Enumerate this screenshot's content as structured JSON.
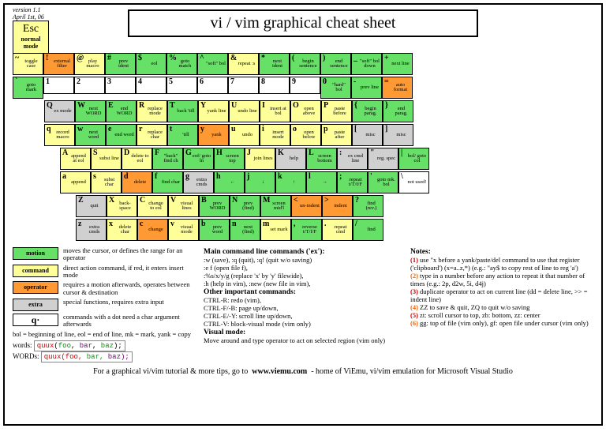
{
  "meta": {
    "version": "version 1.1",
    "date": "April 1st, 06"
  },
  "title": "vi / vim graphical cheat sheet",
  "esc": {
    "key": "Esc",
    "label": "normal mode"
  },
  "row1": [
    {
      "c": "~",
      "l": "toggle case",
      "cls": "y"
    },
    {
      "c": "!",
      "l": "external filter",
      "cls": "o"
    },
    {
      "c": "@",
      "l": "play macro",
      "cls": "y"
    },
    {
      "c": "#",
      "l": "prev ident",
      "cls": "g"
    },
    {
      "c": "$",
      "l": "eol",
      "cls": "g"
    },
    {
      "c": "%",
      "l": "goto match",
      "cls": "g"
    },
    {
      "c": "^",
      "l": "\"soft\" bol",
      "cls": "g"
    },
    {
      "c": "&",
      "l": "repeat :s",
      "cls": "y"
    },
    {
      "c": "*",
      "l": "next ident",
      "cls": "g"
    },
    {
      "c": "(",
      "l": "begin sentence",
      "cls": "g"
    },
    {
      "c": ")",
      "l": "end sentence",
      "cls": "g"
    },
    {
      "c": "_",
      "l": "\"soft\" bol down",
      "cls": "g"
    },
    {
      "c": "+",
      "l": "next line",
      "cls": "g"
    }
  ],
  "row1b": [
    {
      "c": "`",
      "l": "goto mark",
      "cls": "g"
    },
    {
      "c": "1",
      "cls": "wht"
    },
    {
      "c": "2",
      "cls": "wht"
    },
    {
      "c": "3",
      "cls": "wht"
    },
    {
      "c": "4",
      "cls": "wht"
    },
    {
      "c": "5",
      "cls": "wht"
    },
    {
      "c": "6",
      "cls": "wht"
    },
    {
      "c": "7",
      "cls": "wht"
    },
    {
      "c": "8",
      "cls": "wht"
    },
    {
      "c": "9",
      "cls": "wht"
    },
    {
      "c": "0",
      "l": "\"hard\" bol",
      "cls": "g"
    },
    {
      "c": "-",
      "l": "prev line",
      "cls": "g"
    },
    {
      "c": "=",
      "l": "auto format",
      "cls": "o"
    }
  ],
  "row2": [
    {
      "c": "Q",
      "l": "ex mode",
      "cls": "gr"
    },
    {
      "c": "W",
      "l": "next WORD",
      "cls": "g"
    },
    {
      "c": "E",
      "l": "end WORD",
      "cls": "g"
    },
    {
      "c": "R",
      "l": "replace mode",
      "cls": "y"
    },
    {
      "c": "T",
      "l": "back 'till",
      "cls": "g"
    },
    {
      "c": "Y",
      "l": "yank line",
      "cls": "y"
    },
    {
      "c": "U",
      "l": "undo line",
      "cls": "y"
    },
    {
      "c": "I",
      "l": "insert at bol",
      "cls": "y"
    },
    {
      "c": "O",
      "l": "open above",
      "cls": "y"
    },
    {
      "c": "P",
      "l": "paste before",
      "cls": "y"
    },
    {
      "c": "{",
      "l": "begin parag.",
      "cls": "g"
    },
    {
      "c": "}",
      "l": "end parag.",
      "cls": "g"
    }
  ],
  "row2b": [
    {
      "c": "q",
      "l": "record macro",
      "cls": "y"
    },
    {
      "c": "w",
      "l": "next word",
      "cls": "g"
    },
    {
      "c": "e",
      "l": "end word",
      "cls": "g"
    },
    {
      "c": "r",
      "l": "replace char",
      "cls": "y"
    },
    {
      "c": "t",
      "l": "'till",
      "cls": "g"
    },
    {
      "c": "y",
      "l": "yank",
      "cls": "o"
    },
    {
      "c": "u",
      "l": "undo",
      "cls": "y"
    },
    {
      "c": "i",
      "l": "insert mode",
      "cls": "y"
    },
    {
      "c": "o",
      "l": "open below",
      "cls": "y"
    },
    {
      "c": "p",
      "l": "paste after",
      "cls": "y"
    },
    {
      "c": "[",
      "l": "misc",
      "cls": "gr"
    },
    {
      "c": "]",
      "l": "misc",
      "cls": "gr"
    }
  ],
  "row3": [
    {
      "c": "A",
      "l": "append at eol",
      "cls": "y"
    },
    {
      "c": "S",
      "l": "subst line",
      "cls": "y"
    },
    {
      "c": "D",
      "l": "delete to eol",
      "cls": "y"
    },
    {
      "c": "F",
      "l": "\"back\" find ch",
      "cls": "g"
    },
    {
      "c": "G",
      "l": "eof/ goto ln",
      "cls": "g"
    },
    {
      "c": "H",
      "l": "screen top",
      "cls": "g"
    },
    {
      "c": "J",
      "l": "join lines",
      "cls": "y"
    },
    {
      "c": "K",
      "l": "help",
      "cls": "gr"
    },
    {
      "c": "L",
      "l": "screen bottom",
      "cls": "g"
    },
    {
      "c": ":",
      "l": "ex cmd line",
      "cls": "gr"
    },
    {
      "c": "\"",
      "l": "reg. spec",
      "cls": "gr"
    },
    {
      "c": "|",
      "l": "bol/ goto col",
      "cls": "g"
    }
  ],
  "row3b": [
    {
      "c": "a",
      "l": "append",
      "cls": "y"
    },
    {
      "c": "s",
      "l": "subst char",
      "cls": "y"
    },
    {
      "c": "d",
      "l": "delete",
      "cls": "o"
    },
    {
      "c": "f",
      "l": "find char",
      "cls": "g"
    },
    {
      "c": "g",
      "l": "extra cmds",
      "cls": "gr"
    },
    {
      "c": "h",
      "l": "←",
      "cls": "g"
    },
    {
      "c": "j",
      "l": "↓",
      "cls": "g"
    },
    {
      "c": "k",
      "l": "↑",
      "cls": "g"
    },
    {
      "c": "l",
      "l": "→",
      "cls": "g"
    },
    {
      "c": ";",
      "l": "repeat t/T/f/F",
      "cls": "g"
    },
    {
      "c": "'",
      "l": "goto mk. bol",
      "cls": "g"
    },
    {
      "c": "\\",
      "l": "not used!",
      "cls": "wht"
    }
  ],
  "row4": [
    {
      "c": "Z",
      "l": "quit",
      "cls": "gr"
    },
    {
      "c": "X",
      "l": "back-space",
      "cls": "y"
    },
    {
      "c": "C",
      "l": "change to eol",
      "cls": "y"
    },
    {
      "c": "V",
      "l": "visual lines",
      "cls": "y"
    },
    {
      "c": "B",
      "l": "prev WORD",
      "cls": "g"
    },
    {
      "c": "N",
      "l": "prev (find)",
      "cls": "g"
    },
    {
      "c": "M",
      "l": "screen mid'l",
      "cls": "g"
    },
    {
      "c": "<",
      "l": "un-indent",
      "cls": "o"
    },
    {
      "c": ">",
      "l": "indent",
      "cls": "o"
    },
    {
      "c": "?",
      "l": "find (rev.)",
      "cls": "g"
    }
  ],
  "row4b": [
    {
      "c": "z",
      "l": "extra cmds",
      "cls": "gr"
    },
    {
      "c": "x",
      "l": "delete char",
      "cls": "y"
    },
    {
      "c": "c",
      "l": "change",
      "cls": "o"
    },
    {
      "c": "v",
      "l": "visual mode",
      "cls": "y"
    },
    {
      "c": "b",
      "l": "prev word",
      "cls": "g"
    },
    {
      "c": "n",
      "l": "next (find)",
      "cls": "g"
    },
    {
      "c": "m",
      "l": "set mark",
      "cls": "y"
    },
    {
      "c": ",",
      "l": "reverse t/T/f/F",
      "cls": "g"
    },
    {
      "c": ".",
      "l": "repeat cmd",
      "cls": "y"
    },
    {
      "c": "/",
      "l": "find",
      "cls": "g"
    }
  ],
  "legend": {
    "motion": {
      "name": "motion",
      "text": "moves the cursor, or defines the range for an operator"
    },
    "command": {
      "name": "command",
      "text": "direct action command, if red, it enters insert mode"
    },
    "operator": {
      "name": "operator",
      "text": "requires a motion afterwards, operates between cursor & destination"
    },
    "extra": {
      "name": "extra",
      "text": "special functions, requires extra input"
    },
    "qdot": {
      "sym": "q·",
      "text": "commands with a dot need a char argument afterwards"
    },
    "abbrev": "bol = beginning of line, eol = end of line, mk = mark, yank = copy",
    "words_label": "words:",
    "words": "quux(foo, bar, baz);",
    "WORDs_label": "WORDs:",
    "WORDs": "quux(foo, bar, baz);"
  },
  "mid": {
    "h1": "Main command line commands ('ex'):",
    "t1": ":w (save), :q (quit), :q! (quit w/o saving)\n:e f (open file f),\n:%s/x/y/g (replace 'x' by 'y' filewide),\n:h (help in vim), :new (new file in vim),",
    "h2": "Other important commands:",
    "t2": "CTRL-R: redo (vim),\nCTRL-F/-B: page up/down,\nCTRL-E/-Y: scroll line up/down,\nCTRL-V: block-visual mode (vim only)",
    "h3": "Visual mode:",
    "t3": "Move around and type operator to act on selected region (vim only)"
  },
  "notes": {
    "title": "Notes:",
    "n1": "use \"x before a yank/paste/del command to use that register ('clipboard') (x=a..z,*) (e.g.: \"ay$ to copy rest of line to reg 'a')",
    "n2": "type in a number before any action to repeat it that number of times (e.g.: 2p, d2w, 5i, d4j)",
    "n3": "duplicate operator to act on current line (dd = delete line, >> = indent line)",
    "n4": "ZZ to save & quit, ZQ to quit w/o saving",
    "n5": "zt: scroll cursor to top, zb: bottom, zz: center",
    "n6": "gg: top of file (vim only), gf: open file under cursor (vim only)"
  },
  "footer": {
    "text": "For a graphical vi/vim tutorial & more tips, go to",
    "url": "www.viemu.com",
    "tail": "- home of ViEmu, vi/vim emulation for Microsoft Visual Studio"
  }
}
